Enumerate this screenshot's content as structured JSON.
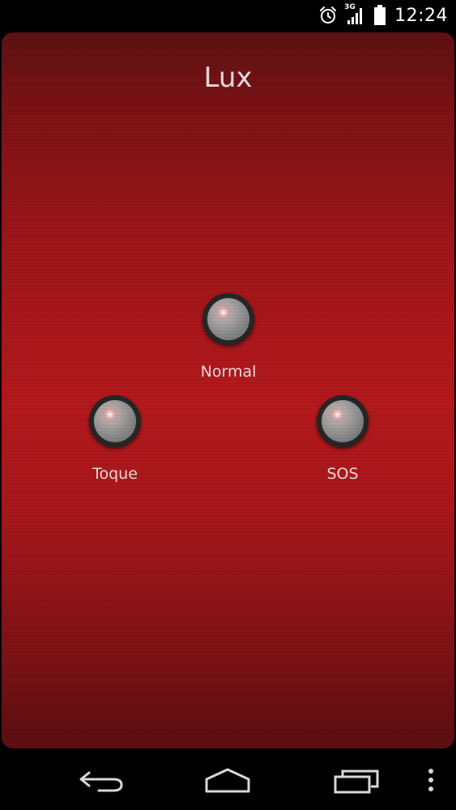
{
  "status_bar": {
    "network": "3G",
    "time": "12:24",
    "icons": [
      "alarm-icon",
      "signal-icon",
      "battery-icon"
    ]
  },
  "app": {
    "title": "Lux",
    "colors": {
      "panel_top": "#5c0f10",
      "panel_mid": "#b3171b",
      "panel_bottom": "#5a0c0e",
      "label": "#e8dcdc"
    }
  },
  "modes": [
    {
      "label": "Normal",
      "icon": "light-lens-icon"
    },
    {
      "label": "Toque",
      "icon": "light-lens-icon"
    },
    {
      "label": "SOS",
      "icon": "light-lens-icon"
    }
  ],
  "nav_bar": {
    "icons": [
      "back-icon",
      "home-icon",
      "recent-apps-icon",
      "overflow-menu-icon"
    ]
  }
}
